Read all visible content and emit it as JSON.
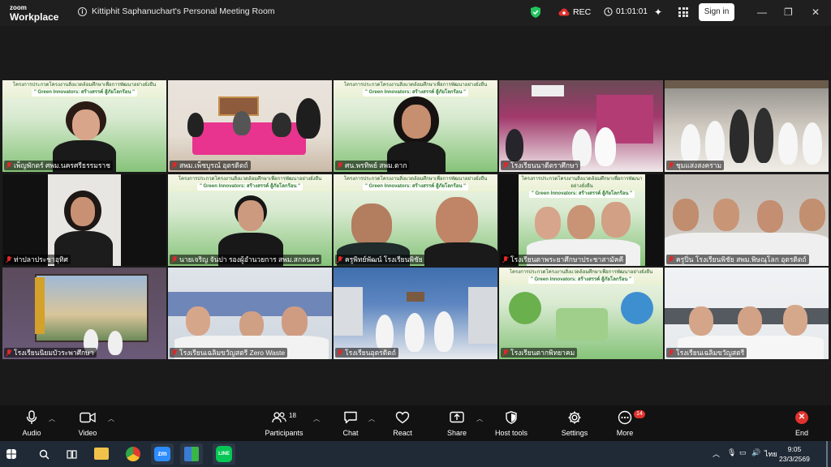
{
  "app": {
    "logo_line1": "zoom",
    "logo_line2": "Workplace",
    "meeting_title": "Kittiphit Saphanuchart's Personal Meeting Room",
    "rec_label": "REC",
    "timer": "01:01:01",
    "signin_label": "Sign in"
  },
  "tiles": [
    {
      "name": "เพ็ญพักตร์ ศพม.นครศรีธรรมราช"
    },
    {
      "name": "สพม.เพ็ชบูรณ์ อุตรดิตถ์"
    },
    {
      "name": "ศน.พรทิพย์  สพม.ตาก"
    },
    {
      "name": "โรงเรียนนาดีตราศึกษา"
    },
    {
      "name": "ชุมแสงสงคราม"
    },
    {
      "name": "ท่าปลาประชาอุทิศ"
    },
    {
      "name": "นายเจริญ จันปา รองผู้อำนวยการ สพม.สกลนคร"
    },
    {
      "name": "ครูพิทย์พัฒน์ โรงเรียนพิชัย"
    },
    {
      "name": "โรงเรียนตาพระยาศึกษาประชาสามัคคี"
    },
    {
      "name": "ครูปิ่น โรงเรียนพิชัย สพม.พิษณุโลก อุตรดิตถ์"
    },
    {
      "name": "โรงเรียนนิยมบัวระพาศึกษา"
    },
    {
      "name": "โรงเรียนเฉลิมขวัญสตรี Zero Waste"
    },
    {
      "name": "โรงเรียนอุตรดิตถ์"
    },
    {
      "name": "โรงเรียนตากพิทยาคม"
    },
    {
      "name": "โรงเรียนเฉลิมขวัญสตรี"
    }
  ],
  "banner": {
    "line1": "โครงการประกวดโครงงานสิ่งแวดล้อมศึกษาเพื่อการพัฒนาอย่างยั่งยืน",
    "line2": "\" Green Innovators: สร้างสรรค์ สู้ภัยโลกร้อน \""
  },
  "toolbar": {
    "audio": "Audio",
    "video": "Video",
    "participants": "Participants",
    "participants_count": "18",
    "chat": "Chat",
    "react": "React",
    "share": "Share",
    "host_tools": "Host tools",
    "settings": "Settings",
    "more": "More",
    "more_badge": "14",
    "end": "End"
  },
  "taskbar": {
    "lang": "ไทย",
    "time": "9:05",
    "date": "23/3/2569"
  },
  "colors": {
    "accent_green": "#3fd37a",
    "end_red": "#e0322d",
    "taskbar": "#202a36"
  }
}
